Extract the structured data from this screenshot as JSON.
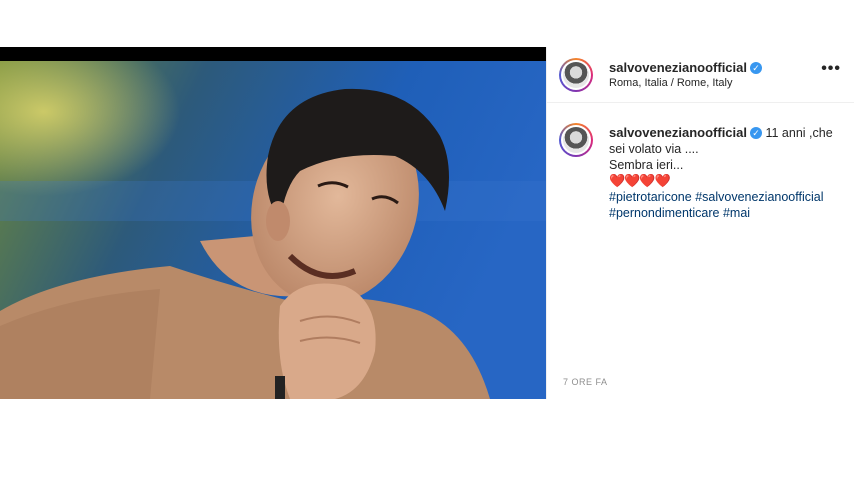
{
  "account": {
    "username": "salvovenezianoofficial",
    "location": "Roma, Italia / Rome, Italy",
    "verified_icon": "verified-badge-icon"
  },
  "menu": {
    "more_label": "•••"
  },
  "caption": {
    "username": "salvovenezianoofficial",
    "text_line1": "11 anni ,che sei volato via ....",
    "text_line2": "Sembra ieri...",
    "hearts": "❤️❤️❤️❤️",
    "hashtags": [
      "#pietrotaricone",
      "#salvovenezianoofficial",
      "#pernondimenticare",
      "#mai"
    ]
  },
  "timestamp": "7 ORE FA",
  "colors": {
    "accent_link": "#00376b",
    "verified": "#3897f0",
    "background_blue": "#1f5fb8"
  }
}
